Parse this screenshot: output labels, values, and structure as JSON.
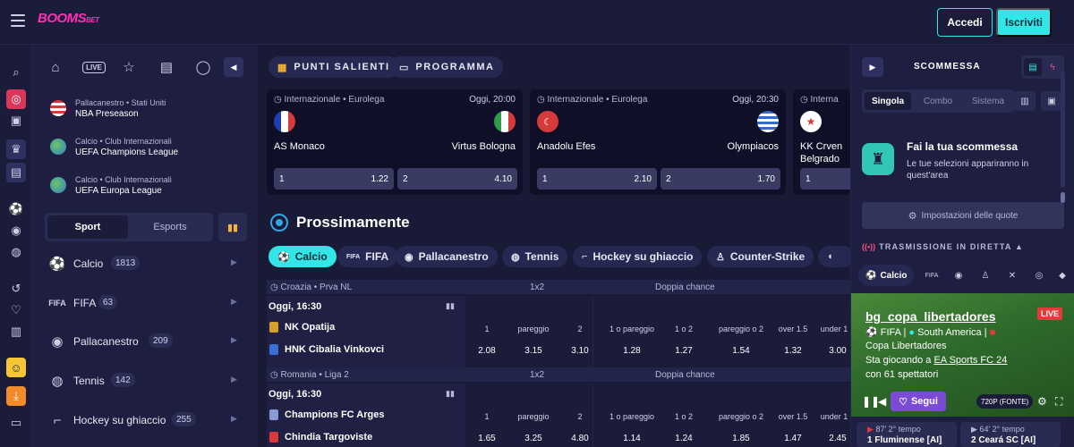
{
  "header": {
    "logo": "BOOMS",
    "logo_suffix": "BET",
    "login_label": "Accedi",
    "register_label": "Iscriviti"
  },
  "left_panel": {
    "favorites": [
      {
        "sub": "Pallacanestro • Stati Uniti",
        "name": "NBA Preseason"
      },
      {
        "sub": "Calcio • Club Internazionali",
        "name": "UEFA Champions League"
      },
      {
        "sub": "Calcio • Club Internazionali",
        "name": "UEFA Europa League"
      }
    ],
    "toggle": {
      "sport": "Sport",
      "esports": "Esports"
    },
    "live_label": "LIVE",
    "sports": [
      {
        "name": "Calcio",
        "count": "1813",
        "icon": "soccer-ball-icon"
      },
      {
        "name": "FIFA",
        "count": "63",
        "icon": "fifa-icon"
      },
      {
        "name": "Pallacanestro",
        "count": "209",
        "icon": "basketball-icon"
      },
      {
        "name": "Tennis",
        "count": "142",
        "icon": "tennis-icon"
      },
      {
        "name": "Hockey su ghiaccio",
        "count": "255",
        "icon": "hockey-icon"
      }
    ]
  },
  "center": {
    "tabs": {
      "highlights": "PUNTI SALIENTI",
      "schedule": "PROGRAMMA"
    },
    "featured": [
      {
        "competition": "Internazionale • Eurolega",
        "time": "Oggi, 20:00",
        "home": "AS Monaco",
        "away": "Virtus Bologna",
        "odd1_label": "1",
        "odd1": "1.22",
        "odd2_label": "2",
        "odd2": "4.10"
      },
      {
        "competition": "Internazionale • Eurolega",
        "time": "Oggi, 20:30",
        "home": "Anadolu Efes",
        "away": "Olympiacos",
        "odd1_label": "1",
        "odd1": "2.10",
        "odd2_label": "2",
        "odd2": "1.70"
      },
      {
        "competition": "Interna",
        "home": "KK Crven",
        "home2": "Belgrado",
        "odd1_label": "1"
      }
    ],
    "section_title": "Prossimamente",
    "sport_chips": [
      {
        "label": "Calcio"
      },
      {
        "label": "FIFA",
        "icon_text": "FIFA"
      },
      {
        "label": "Pallacanestro"
      },
      {
        "label": "Tennis"
      },
      {
        "label": "Hockey su ghiaccio"
      },
      {
        "label": "Counter-Strike"
      }
    ],
    "groups": {
      "g1": "1x2",
      "g2": "Doppia chance"
    },
    "headers": [
      "1",
      "pareggio",
      "2",
      "1 o pareggio",
      "1 o 2",
      "pareggio o 2",
      "over 1.5",
      "under 1"
    ],
    "matches": [
      {
        "league": "Croazia • Prva NL",
        "time": "Oggi, 16:30",
        "home": "NK Opatija",
        "away": "HNK Cibalia Vinkovci",
        "odds": [
          "2.08",
          "3.15",
          "3.10",
          "1.28",
          "1.27",
          "1.54",
          "1.32",
          "3.00"
        ]
      },
      {
        "league": "Romania • Liga 2",
        "time": "Oggi, 16:30",
        "home": "Champions FC Arges",
        "away": "Chindia Targoviste",
        "odds": [
          "1.65",
          "3.25",
          "4.80",
          "1.14",
          "1.24",
          "1.85",
          "1.47",
          "2.45"
        ]
      }
    ]
  },
  "right_panel": {
    "title": "SCOMMESSA",
    "bet_types": [
      "Singola",
      "Combo",
      "Sistema"
    ],
    "empty_title": "Fai la tua scommessa",
    "empty_text": "Le tue selezioni appariranno in quest'area",
    "odds_settings": "Impostazioni delle quote",
    "stream_header": "TRASMISSIONE IN DIRETTA",
    "stream_chip": "Calcio",
    "stream_chip_fifa": "FIFA",
    "video": {
      "channel": "bg_copa_libertadores",
      "live": "LIVE",
      "game": "FIFA",
      "region": "South America",
      "title": "Copa Libertadores",
      "playing_prefix": "Sta giocando a ",
      "playing_game": "EA Sports FC 24",
      "viewers": "con 61 spettatori",
      "follow": "Segui",
      "quality": "720P (FONTE)"
    },
    "mini_matches": [
      {
        "time": "87' 2° tempo",
        "team": "1  Fluminense [AI]"
      },
      {
        "time": "64' 2° tempo",
        "team": "2  Ceará SC [AI]"
      }
    ]
  },
  "colors": {
    "accent": "#31e6e6",
    "brand": "#ff2fb6",
    "background": "#1b1c3a",
    "live_red": "#e33a3a",
    "follow_purple": "#7c4bd6"
  }
}
